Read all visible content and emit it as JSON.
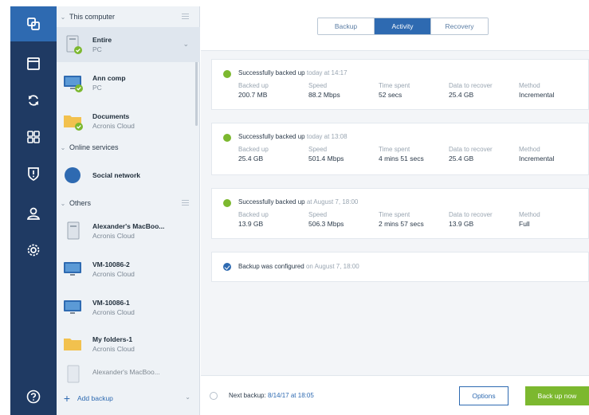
{
  "rail": {
    "items": [
      {
        "name": "backup-icon"
      },
      {
        "name": "archive-icon"
      },
      {
        "name": "sync-icon"
      },
      {
        "name": "tools-icon"
      },
      {
        "name": "protection-icon"
      },
      {
        "name": "account-icon"
      },
      {
        "name": "settings-icon"
      },
      {
        "name": "help-icon"
      }
    ]
  },
  "sources": {
    "this_computer_label": "This computer",
    "online_services_label": "Online services",
    "others_label": "Others",
    "add_backup_label": "Add backup",
    "items": [
      {
        "name": "Entire",
        "sub": "PC"
      },
      {
        "name": "Ann comp",
        "sub": "PC"
      },
      {
        "name": "Documents",
        "sub": "Acronis Cloud"
      },
      {
        "name": "Social network",
        "sub": ""
      },
      {
        "name": "Alexander's MacBoo...",
        "sub": "Acronis Cloud"
      },
      {
        "name": "VM-10086-2",
        "sub": "Acronis Cloud"
      },
      {
        "name": "VM-10086-1",
        "sub": "Acronis Cloud"
      },
      {
        "name": "My folders-1",
        "sub": "Acronis Cloud"
      },
      {
        "name": "Alexander's MacBoo...",
        "sub": ""
      }
    ]
  },
  "tabs": {
    "backup": "Backup",
    "activity": "Activity",
    "recovery": "Recovery"
  },
  "metric_labels": {
    "backed_up": "Backed up",
    "speed": "Speed",
    "time_spent": "Time spent",
    "data_to_recover": "Data to recover",
    "method": "Method"
  },
  "activity": [
    {
      "status": "Successfully backed up",
      "when": "today at 14:17",
      "backed_up": "200.7 MB",
      "speed": "88.2 Mbps",
      "time_spent": "52 secs",
      "data_to_recover": "25.4 GB",
      "method": "Incremental"
    },
    {
      "status": "Successfully backed up",
      "when": "today at 13:08",
      "backed_up": "25.4 GB",
      "speed": "501.4 Mbps",
      "time_spent": "4 mins 51 secs",
      "data_to_recover": "25.4 GB",
      "method": "Incremental"
    },
    {
      "status": "Successfully backed up",
      "when": "at August 7, 18:00",
      "backed_up": "13.9 GB",
      "speed": "506.3 Mbps",
      "time_spent": "2 mins 57 secs",
      "data_to_recover": "13.9 GB",
      "method": "Full"
    }
  ],
  "configured": {
    "status": "Backup was configured",
    "when": "on August 7, 18:00"
  },
  "footer": {
    "next_label": "Next backup:",
    "next_value": "8/14/17 at 18:05",
    "options_label": "Options",
    "backup_now_label": "Back up now"
  },
  "colors": {
    "rail": "#1f3a63",
    "accent": "#2e6ab1",
    "success": "#7cb82f"
  }
}
